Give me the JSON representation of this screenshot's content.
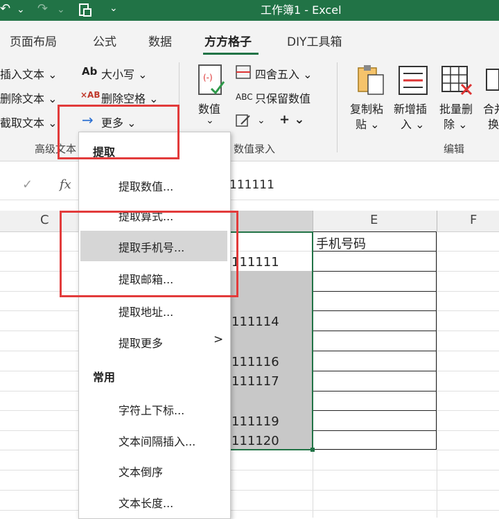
{
  "title_bar": {
    "title": "工作簿1  -  Excel",
    "qa_undo": "↶",
    "qa_dropdown1": "⌄",
    "qa_redo": "↷",
    "qa_dropdown2": "⌄",
    "qa_custom": "⌄"
  },
  "tabs": [
    "页面布局",
    "公式",
    "数据",
    "方方格子",
    "DIY工具箱"
  ],
  "active_tab": "方方格子",
  "ribbon": {
    "insert_text": "插入文本 ⌄",
    "delete_text": "删除文本 ⌄",
    "extract_text": "截取文本 ⌄",
    "case": "大小写 ⌄",
    "case_icon": "Ab",
    "delete_space": "删除空格 ⌄",
    "delete_space_icon": "×AB",
    "more": "更多 ⌄",
    "group_text": "高级文本",
    "value_btn": "数值",
    "value_chevron": "⌄",
    "round": "四舍五入  ⌄",
    "keep_value": "只保留数值",
    "keep_value_icon": "ABC",
    "plus": "+  ⌄",
    "edit_chevron": "⌄",
    "group_value": "数值录入",
    "copy_paste_1": "复制粘",
    "copy_paste_2": "贴 ⌄",
    "insert_new_1": "新增插",
    "insert_new_2": "入 ⌄",
    "batch_del_1": "批量删",
    "batch_del_2": "除 ⌄",
    "merge_1": "合并",
    "merge_2": "换",
    "group_edit": "编辑"
  },
  "formula_bar": {
    "cancel": "✓",
    "fx": "fx",
    "value": "111111"
  },
  "columns": [
    "C",
    "E",
    "F"
  ],
  "cells": {
    "e1": "手机号码",
    "d2": "111111",
    "d5": "111114",
    "d7": "111116",
    "d8": "111117",
    "d10": "111119",
    "d11": "111120"
  },
  "menu": {
    "section1": "提取",
    "items1": [
      "提取数值...",
      "提取算式...",
      "提取手机号...",
      "提取邮箱...",
      "提取地址...",
      "提取更多"
    ],
    "more_arrow": ">",
    "section2": "常用",
    "items2": [
      "字符上下标...",
      "文本间隔插入...",
      "文本倒序",
      "文本长度..."
    ]
  },
  "colors": {
    "excel_green": "#217346",
    "highlight_red": "#e23b3b",
    "selection_gray": "#c8c8c8"
  }
}
